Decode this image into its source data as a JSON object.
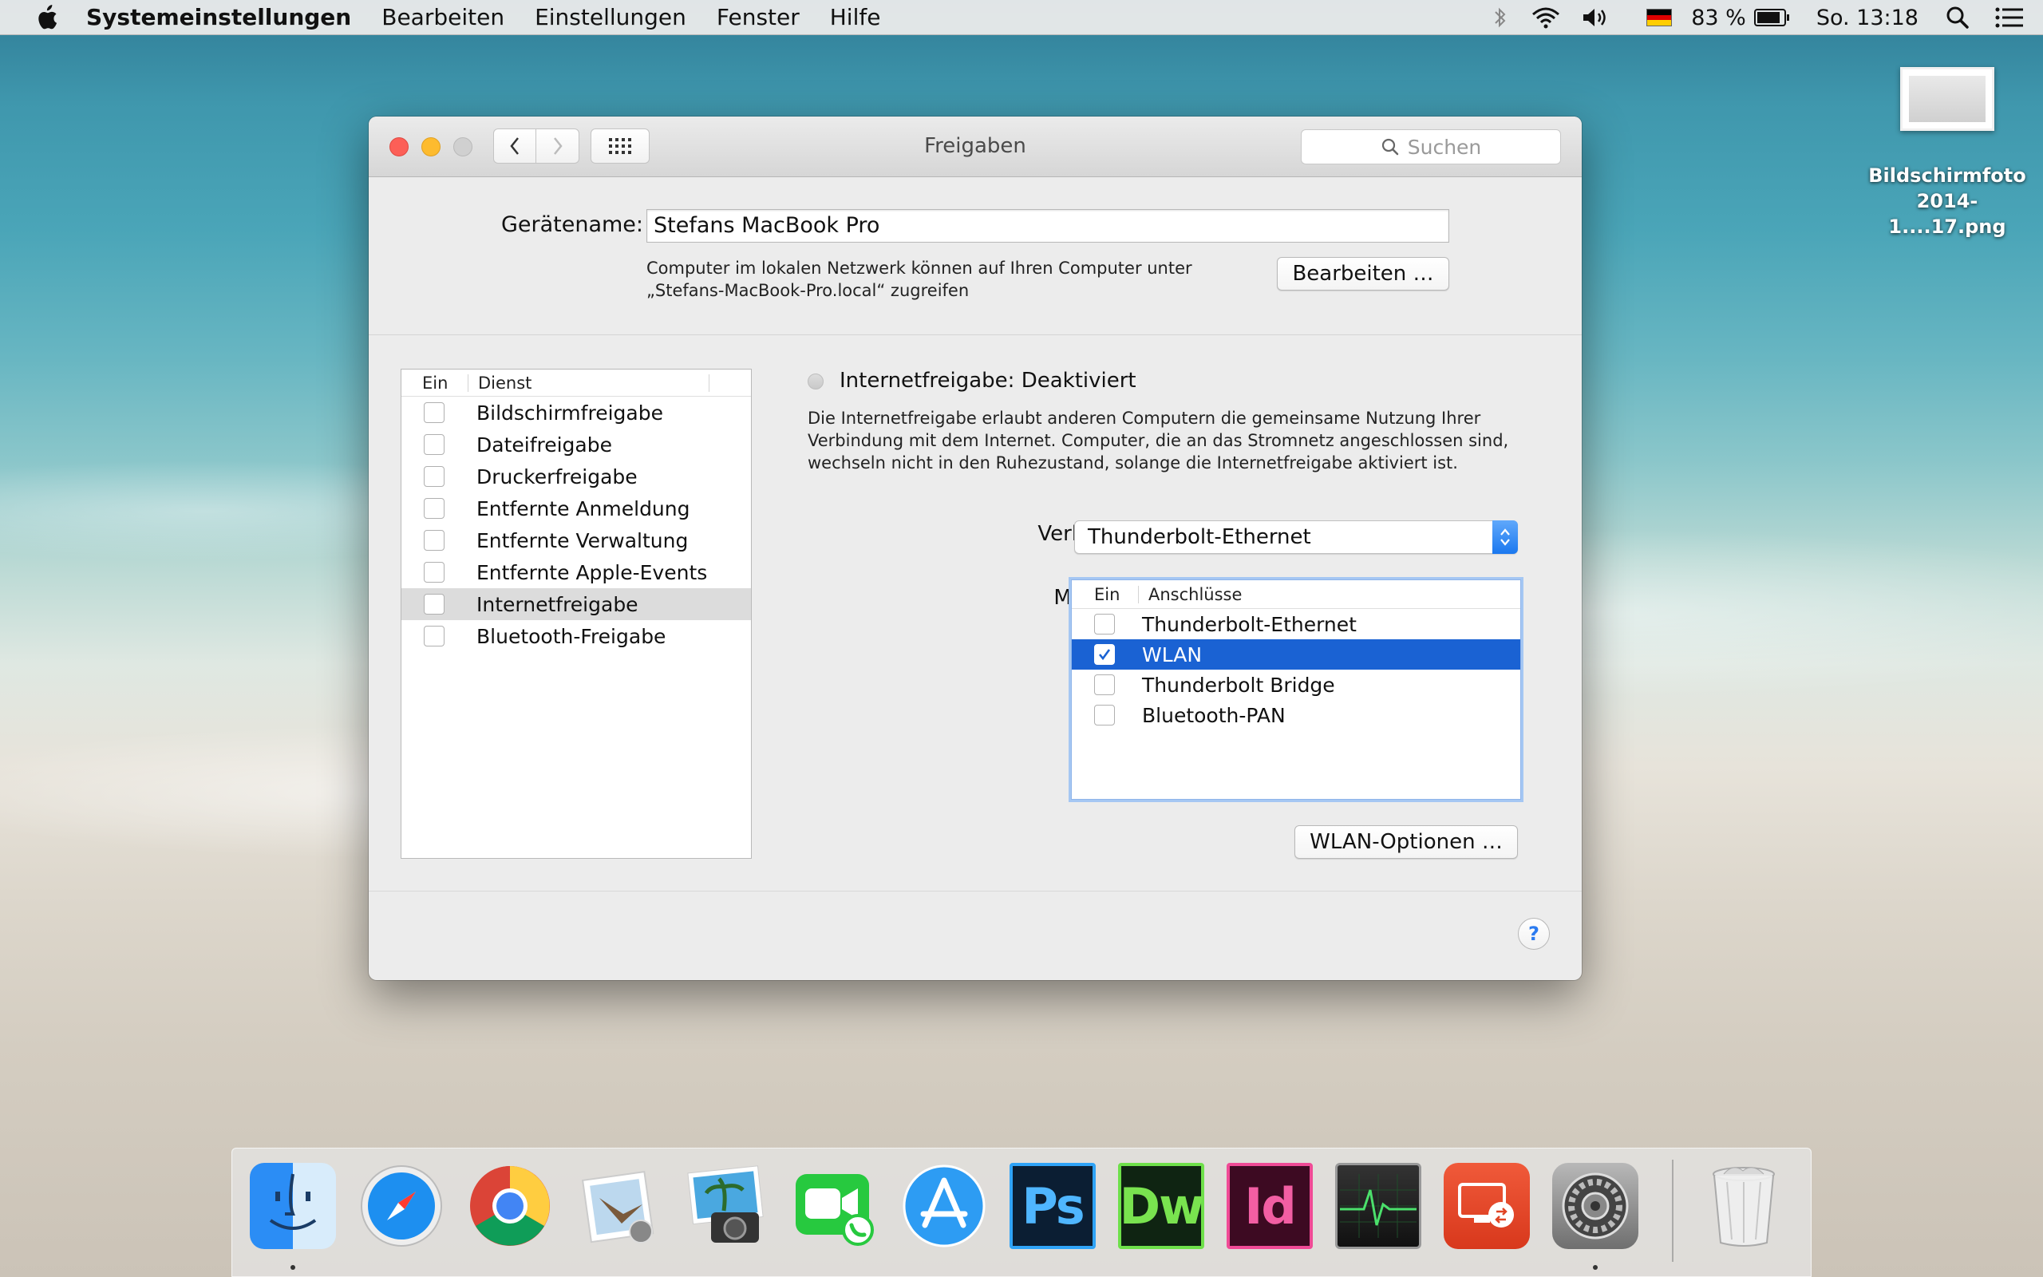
{
  "menubar": {
    "app_name": "Systemeinstellungen",
    "items": [
      "Bearbeiten",
      "Einstellungen",
      "Fenster",
      "Hilfe"
    ],
    "battery": "83 %",
    "clock": "So. 13:18"
  },
  "desktop_file": {
    "line1": "Bildschirmfoto",
    "line2": "2014-1....17.png"
  },
  "window": {
    "title": "Freigaben",
    "search_placeholder": "Suchen",
    "device_name_label": "Gerätename:",
    "device_name_value": "Stefans MacBook Pro",
    "device_desc_line1": "Computer im lokalen Netzwerk können auf Ihren Computer unter",
    "device_desc_line2": "„Stefans-MacBook-Pro.local“ zugreifen",
    "edit_button": "Bearbeiten …",
    "services": {
      "header_on": "Ein",
      "header_service": "Dienst",
      "items": [
        {
          "label": "Bildschirmfreigabe",
          "checked": false,
          "selected": false
        },
        {
          "label": "Dateifreigabe",
          "checked": false,
          "selected": false
        },
        {
          "label": "Druckerfreigabe",
          "checked": false,
          "selected": false
        },
        {
          "label": "Entfernte Anmeldung",
          "checked": false,
          "selected": false
        },
        {
          "label": "Entfernte Verwaltung",
          "checked": false,
          "selected": false
        },
        {
          "label": "Entfernte Apple-Events",
          "checked": false,
          "selected": false
        },
        {
          "label": "Internetfreigabe",
          "checked": false,
          "selected": true
        },
        {
          "label": "Bluetooth-Freigabe",
          "checked": false,
          "selected": false
        }
      ]
    },
    "status_title": "Internetfreigabe: Deaktiviert",
    "status_desc_line1": "Die Internetfreigabe erlaubt anderen Computern die gemeinsame Nutzung Ihrer",
    "status_desc_line2": "Verbindung mit dem Internet. Computer, die an das Stromnetz angeschlossen sind,",
    "status_desc_line3": "wechseln nicht in den Ruhezustand, solange die Internetfreigabe aktiviert ist.",
    "share_from_label": "Verbindung freigeben:",
    "share_from_value": "Thunderbolt-Ethernet",
    "to_computers_label": "Mit Computern über:",
    "ports": {
      "header_on": "Ein",
      "header_ports": "Anschlüsse",
      "items": [
        {
          "label": "Thunderbolt-Ethernet",
          "checked": false,
          "selected": false
        },
        {
          "label": "WLAN",
          "checked": true,
          "selected": true
        },
        {
          "label": "Thunderbolt Bridge",
          "checked": false,
          "selected": false
        },
        {
          "label": "Bluetooth-PAN",
          "checked": false,
          "selected": false
        }
      ]
    },
    "wlan_options_button": "WLAN-Optionen …",
    "help_button": "?"
  },
  "dock": {
    "apps": [
      "finder-icon",
      "safari-icon",
      "chrome-icon",
      "mail-icon",
      "iphoto-icon",
      "facetime-icon",
      "app-store-icon",
      "photoshop-icon",
      "dreamweaver-icon",
      "indesign-icon",
      "activity-monitor-icon",
      "remote-desktop-icon",
      "system-preferences-icon",
      "trash-icon"
    ],
    "photoshop_label": "Ps",
    "dreamweaver_label": "Dw",
    "indesign_label": "Id"
  }
}
